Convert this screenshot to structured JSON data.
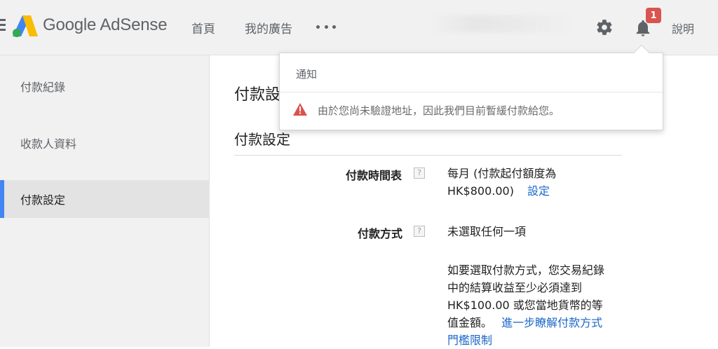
{
  "header": {
    "brand": "Google AdSense",
    "nav": [
      {
        "label": "首頁"
      },
      {
        "label": "我的廣告"
      }
    ],
    "notification_count": "1",
    "help_label": "說明",
    "icons": {
      "menu": "hamburger-icon",
      "more": "more-horizontal-icon",
      "settings": "gear-icon",
      "notifications": "bell-icon"
    }
  },
  "sidebar": {
    "items": [
      {
        "label": "付款紀錄",
        "active": false
      },
      {
        "label": "收款人資料",
        "active": false
      },
      {
        "label": "付款設定",
        "active": true
      }
    ]
  },
  "main": {
    "page_title": "付款設定",
    "section_title": "付款設定",
    "fields": [
      {
        "label": "付款時間表",
        "help": "?",
        "value_line1": "每月 (付款起付額度為",
        "value_line2": "HK$800.00)",
        "link": "設定"
      },
      {
        "label": "付款方式",
        "help": "?",
        "value": "未選取任何一項",
        "note_lines": [
          "如要選取付款方式，您交易紀錄",
          "中的結算收益至少必須達到",
          "HK$100.00 或您當地貨幣的等",
          "值金額。"
        ],
        "note_link_line1": "進一步瞭解付款方式",
        "note_link_line2": "門檻限制"
      }
    ]
  },
  "notification_popover": {
    "title": "通知",
    "message": "由於您尚未驗證地址，因此我們目前暫緩付款給您。"
  },
  "colors": {
    "accent": "#4285f4",
    "link": "#1a67c7",
    "badge": "#d9534f",
    "warning": "#d9534f",
    "header_bg": "#f1f1f1"
  }
}
